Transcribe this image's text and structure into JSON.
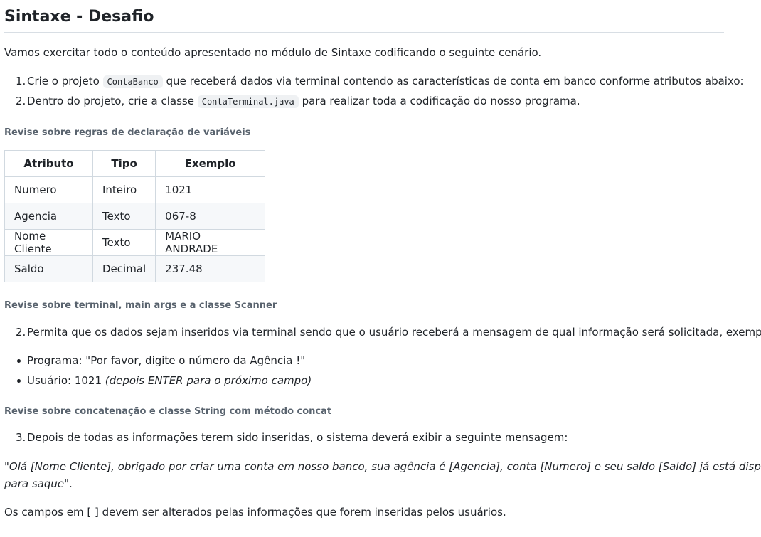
{
  "title": "Sintaxe - Desafio",
  "intro": "Vamos exercitar todo o conteúdo apresentado no módulo de Sintaxe codificando o seguinte cenário.",
  "list1": [
    {
      "num": "1.",
      "before": "Crie o projeto",
      "code": "ContaBanco",
      "after": "que receberá dados via terminal contendo as características de conta em banco conforme atributos abaixo:"
    },
    {
      "num": "2.",
      "before": "Dentro do projeto, crie a classe",
      "code": "ContaTerminal.java",
      "after": "para realizar toda a codificação do nosso programa."
    }
  ],
  "review1": "Revise sobre regras de declaração de variáveis",
  "table": {
    "headers": [
      "Atributo",
      "Tipo",
      "Exemplo"
    ],
    "rows": [
      [
        "Numero",
        "Inteiro",
        "1021"
      ],
      [
        "Agencia",
        "Texto",
        "067-8"
      ],
      [
        "Nome Cliente",
        "Texto",
        "MARIO ANDRADE"
      ],
      [
        "Saldo",
        "Decimal",
        "237.48"
      ]
    ]
  },
  "review2": "Revise sobre terminal, main args e a classe Scanner",
  "step2": {
    "num": "2.",
    "text": "Permita que os dados sejam inseridos via terminal sendo que o usuário receberá a mensagem de qual informação será solicitada, exemplo:"
  },
  "bullets": {
    "programa": "Programa: \"Por favor, digite o número da Agência !\"",
    "usuario": "Usuário: 1021",
    "usuario_note": "(depois ENTER para o próximo campo)"
  },
  "review3": "Revise sobre concatenação e classe String com método concat",
  "step3": {
    "num": "3.",
    "text": "Depois de todas as informações terem sido inseridas, o sistema deverá exibir a seguinte mensagem:"
  },
  "message_line1": "\"Olá [Nome Cliente], obrigado por criar uma conta em nosso banco, sua agência é [Agencia], conta [Numero] e seu saldo [Saldo] já está disponível",
  "message_line2": "para saque\"",
  "message_end": ".",
  "footer": "Os campos em [ ] devem ser alterados pelas informações que forem inseridas pelos usuários."
}
